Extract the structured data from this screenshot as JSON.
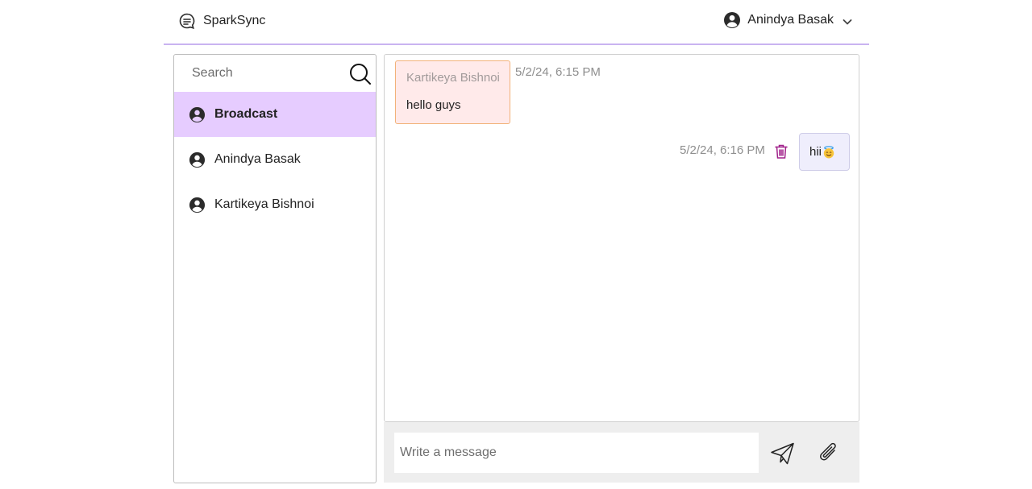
{
  "header": {
    "brand_name": "SparkSync",
    "brand_icon": "chat-bubble-icon",
    "user_name": "Anindya Basak",
    "user_icon": "account-circle-icon",
    "menu_icon": "chevron-down-icon",
    "accent_color": "#c9b3f0"
  },
  "sidebar": {
    "search": {
      "placeholder": "Search",
      "value": ""
    },
    "search_icon": "search-icon",
    "contacts": [
      {
        "label": "Broadcast",
        "active": true
      },
      {
        "label": "Anindya Basak",
        "active": false
      },
      {
        "label": "Kartikeya Bishnoi",
        "active": false
      }
    ],
    "active_color": "#e6ccff"
  },
  "chat": {
    "messages": [
      {
        "direction": "incoming",
        "sender": "Kartikeya Bishnoi",
        "text": "hello guys",
        "timestamp": "5/2/24, 6:15 PM"
      },
      {
        "direction": "outgoing",
        "text": "hii",
        "emoji": "smiling-face-with-halo",
        "timestamp": "5/2/24, 6:16 PM",
        "delete_icon": "trash-icon"
      }
    ]
  },
  "composer": {
    "placeholder": "Write a message",
    "value": "",
    "send_icon": "send-icon",
    "attach_icon": "paperclip-icon"
  }
}
